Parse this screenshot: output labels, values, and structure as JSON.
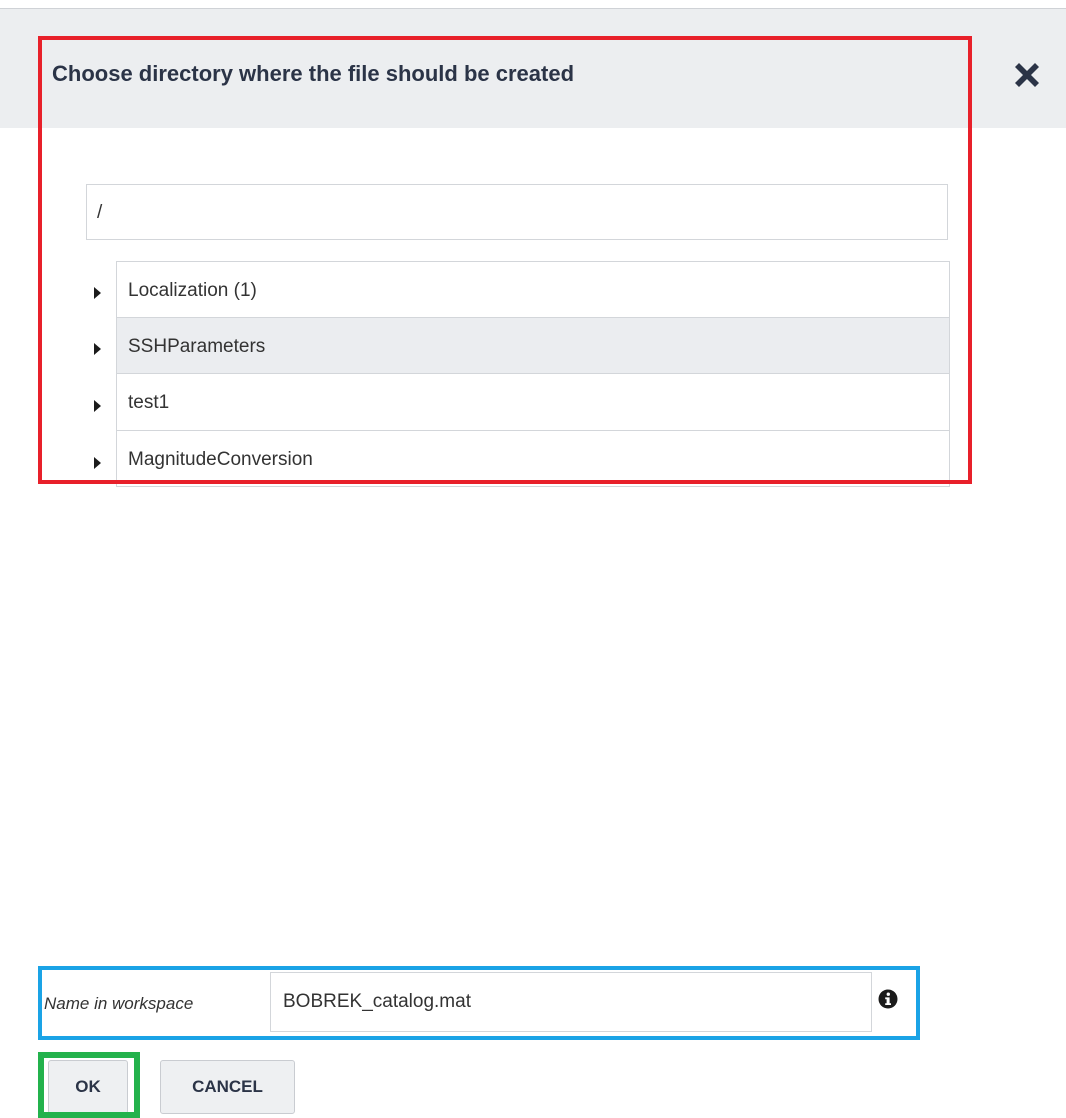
{
  "dialog": {
    "title": "Choose directory where the file should be created",
    "close_icon": "close-icon"
  },
  "path": {
    "value": "/"
  },
  "tree": {
    "expand_icon": "caret-right-icon",
    "items": [
      {
        "label": "Localization (1)",
        "highlighted": false
      },
      {
        "label": "SSHParameters",
        "highlighted": true
      },
      {
        "label": "test1",
        "highlighted": false
      },
      {
        "label": "MagnitudeConversion",
        "highlighted": false
      }
    ]
  },
  "workspace": {
    "label": "Name in workspace",
    "value": "BOBREK_catalog.mat",
    "info_icon": "info-icon"
  },
  "buttons": {
    "ok": "OK",
    "cancel": "CANCEL"
  },
  "colors": {
    "header_bg": "#eceef0",
    "title": "#2b3447",
    "highlight_row": "#ebedf0",
    "annotation_red": "#e8202a",
    "annotation_blue": "#1aa3e6",
    "annotation_green": "#23b24c"
  }
}
